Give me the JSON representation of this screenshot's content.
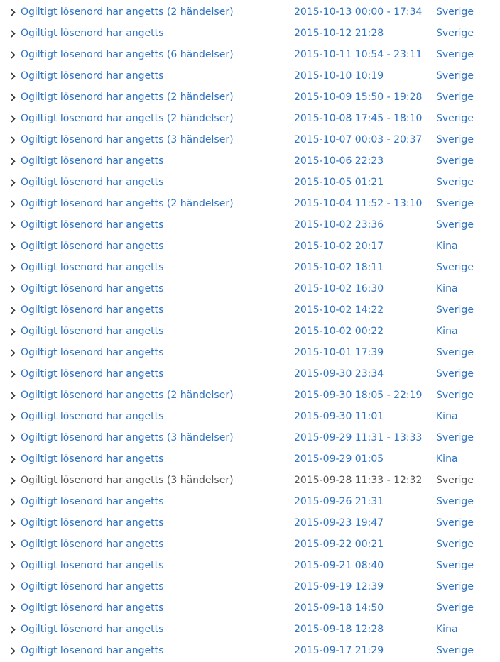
{
  "activity_list": {
    "selected_index": 22,
    "rows": [
      {
        "activity": "Ogiltigt lösenord har angetts (2 händelser)",
        "date": "2015-10-13 00:00 - 17:34",
        "location": "Sverige"
      },
      {
        "activity": "Ogiltigt lösenord har angetts",
        "date": "2015-10-12 21:28",
        "location": "Sverige"
      },
      {
        "activity": "Ogiltigt lösenord har angetts (6 händelser)",
        "date": "2015-10-11 10:54 - 23:11",
        "location": "Sverige"
      },
      {
        "activity": "Ogiltigt lösenord har angetts",
        "date": "2015-10-10 10:19",
        "location": "Sverige"
      },
      {
        "activity": "Ogiltigt lösenord har angetts (2 händelser)",
        "date": "2015-10-09 15:50 - 19:28",
        "location": "Sverige"
      },
      {
        "activity": "Ogiltigt lösenord har angetts (2 händelser)",
        "date": "2015-10-08 17:45 - 18:10",
        "location": "Sverige"
      },
      {
        "activity": "Ogiltigt lösenord har angetts (3 händelser)",
        "date": "2015-10-07 00:03 - 20:37",
        "location": "Sverige"
      },
      {
        "activity": "Ogiltigt lösenord har angetts",
        "date": "2015-10-06 22:23",
        "location": "Sverige"
      },
      {
        "activity": "Ogiltigt lösenord har angetts",
        "date": "2015-10-05 01:21",
        "location": "Sverige"
      },
      {
        "activity": "Ogiltigt lösenord har angetts (2 händelser)",
        "date": "2015-10-04 11:52 - 13:10",
        "location": "Sverige"
      },
      {
        "activity": "Ogiltigt lösenord har angetts",
        "date": "2015-10-02 23:36",
        "location": "Sverige"
      },
      {
        "activity": "Ogiltigt lösenord har angetts",
        "date": "2015-10-02 20:17",
        "location": "Kina"
      },
      {
        "activity": "Ogiltigt lösenord har angetts",
        "date": "2015-10-02 18:11",
        "location": "Sverige"
      },
      {
        "activity": "Ogiltigt lösenord har angetts",
        "date": "2015-10-02 16:30",
        "location": "Kina"
      },
      {
        "activity": "Ogiltigt lösenord har angetts",
        "date": "2015-10-02 14:22",
        "location": "Sverige"
      },
      {
        "activity": "Ogiltigt lösenord har angetts",
        "date": "2015-10-02 00:22",
        "location": "Kina"
      },
      {
        "activity": "Ogiltigt lösenord har angetts",
        "date": "2015-10-01 17:39",
        "location": "Sverige"
      },
      {
        "activity": "Ogiltigt lösenord har angetts",
        "date": "2015-09-30 23:34",
        "location": "Sverige"
      },
      {
        "activity": "Ogiltigt lösenord har angetts (2 händelser)",
        "date": "2015-09-30 18:05 - 22:19",
        "location": "Sverige"
      },
      {
        "activity": "Ogiltigt lösenord har angetts",
        "date": "2015-09-30 11:01",
        "location": "Kina"
      },
      {
        "activity": "Ogiltigt lösenord har angetts (3 händelser)",
        "date": "2015-09-29 11:31 - 13:33",
        "location": "Sverige"
      },
      {
        "activity": "Ogiltigt lösenord har angetts",
        "date": "2015-09-29 01:05",
        "location": "Kina"
      },
      {
        "activity": "Ogiltigt lösenord har angetts (3 händelser)",
        "date": "2015-09-28 11:33 - 12:32",
        "location": "Sverige"
      },
      {
        "activity": "Ogiltigt lösenord har angetts",
        "date": "2015-09-26 21:31",
        "location": "Sverige"
      },
      {
        "activity": "Ogiltigt lösenord har angetts",
        "date": "2015-09-23 19:47",
        "location": "Sverige"
      },
      {
        "activity": "Ogiltigt lösenord har angetts",
        "date": "2015-09-22 00:21",
        "location": "Sverige"
      },
      {
        "activity": "Ogiltigt lösenord har angetts",
        "date": "2015-09-21 08:40",
        "location": "Sverige"
      },
      {
        "activity": "Ogiltigt lösenord har angetts",
        "date": "2015-09-19 12:39",
        "location": "Sverige"
      },
      {
        "activity": "Ogiltigt lösenord har angetts",
        "date": "2015-09-18 14:50",
        "location": "Sverige"
      },
      {
        "activity": "Ogiltigt lösenord har angetts",
        "date": "2015-09-18 12:28",
        "location": "Kina"
      },
      {
        "activity": "Ogiltigt lösenord har angetts",
        "date": "2015-09-17 21:29",
        "location": "Sverige"
      }
    ]
  },
  "icons": {
    "expand": "chevron-right-icon"
  },
  "colors": {
    "link": "#2f73c2",
    "selected_text": "#555555",
    "chevron": "#333333"
  }
}
